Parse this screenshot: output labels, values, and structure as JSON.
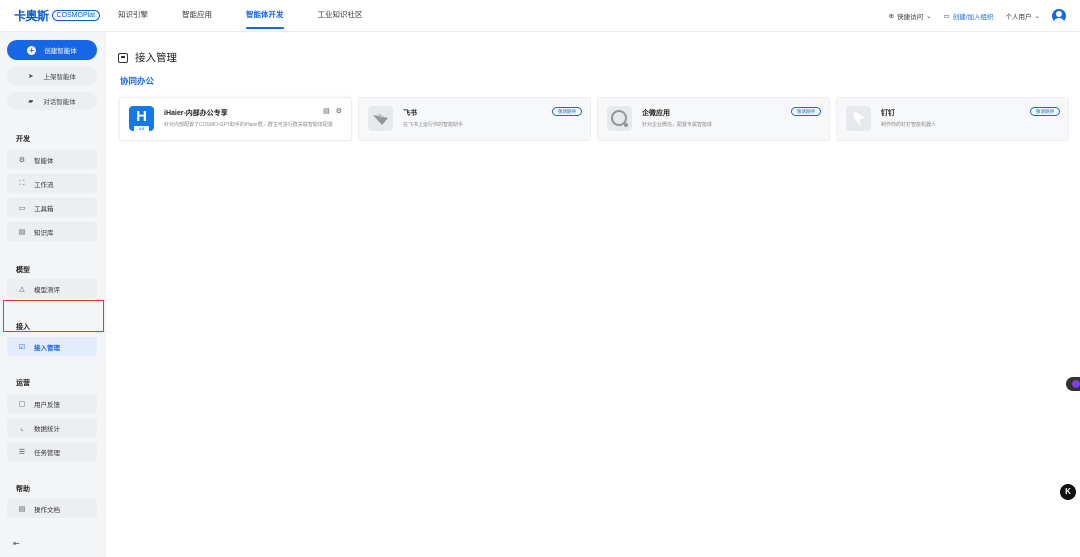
{
  "header": {
    "logo_cn": "卡奥斯",
    "logo_en": "COSMOPlat",
    "nav": [
      {
        "label": "知识引擎"
      },
      {
        "label": "智能应用"
      },
      {
        "label": "智能体开发",
        "active": true
      },
      {
        "label": "工业知识社区"
      }
    ],
    "quick_access": "快捷访问",
    "create_org": "创建/加入组织",
    "user": "个人用户"
  },
  "sidebar": {
    "create_agent": "创建智能体",
    "publish_agent": "上架智能体",
    "chat_agent": "对话智能体",
    "sections": [
      {
        "title": "开发",
        "items": [
          "智能体",
          "工作流",
          "工具箱",
          "知识库"
        ]
      },
      {
        "title": "模型",
        "items": [
          "模型测评"
        ]
      },
      {
        "title": "接入",
        "items": [
          "接入管理"
        ]
      },
      {
        "title": "运营",
        "items": [
          "用户反馈",
          "数据统计",
          "任务管理"
        ]
      },
      {
        "title": "帮助",
        "items": [
          "操作文档"
        ]
      }
    ],
    "active_item": "接入管理"
  },
  "main": {
    "title": "接入管理",
    "section": "协同办公",
    "cards": [
      {
        "title": "iHaier-内部办公专享",
        "desc": "针对内部配置了COSMO-GPT助手的iHaier群，群主可进行群关联智能体配置",
        "logo_text": "H",
        "logo_ver": "2.0"
      },
      {
        "title": "飞书",
        "desc": "在飞书上运行你的智能助手",
        "badge": "敬请期待"
      },
      {
        "title": "企微应用",
        "desc": "针对企业微信，配置专属智能体",
        "badge": "敬请期待"
      },
      {
        "title": "钉钉",
        "desc": "制作你的钉钉智能机器人",
        "badge": "敬请期待"
      }
    ]
  },
  "float_k": "K",
  "colors": {
    "accent": "#1766e6",
    "highlight": "#e53935"
  }
}
